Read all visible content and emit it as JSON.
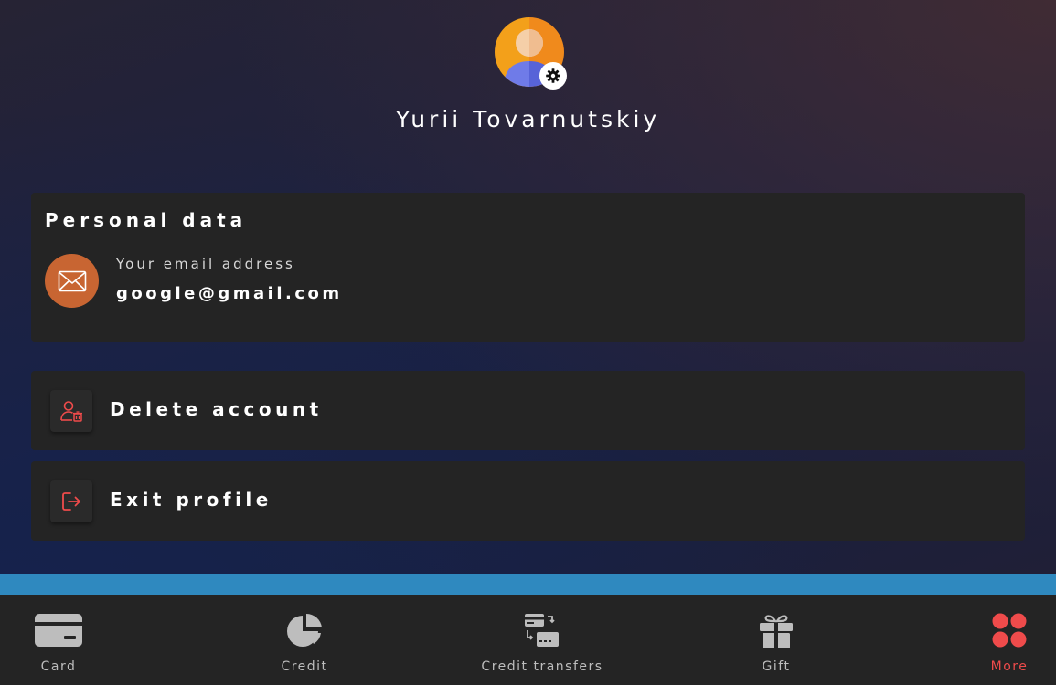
{
  "profile": {
    "name": "Yurii Tovarnutskiy",
    "avatar_icon": "user-avatar-icon",
    "settings_icon": "gear-icon"
  },
  "personal_data": {
    "title": "Personal data",
    "email_label": "Your email address",
    "email_value": "google@gmail.com",
    "email_icon": "envelope-icon"
  },
  "actions": {
    "delete_account": {
      "label": "Delete account",
      "icon": "user-delete-icon"
    },
    "exit_profile": {
      "label": "Exit profile",
      "icon": "logout-icon"
    }
  },
  "bottom_nav": {
    "card": {
      "label": "Card",
      "icon": "credit-card-icon"
    },
    "credit": {
      "label": "Credit",
      "icon": "pie-chart-icon"
    },
    "credit_transfers": {
      "label": "Credit transfers",
      "icon": "transfer-icon"
    },
    "gift": {
      "label": "Gift",
      "icon": "gift-icon"
    },
    "more": {
      "label": "More",
      "icon": "more-dots-icon",
      "active": true
    }
  },
  "colors": {
    "accent_red": "#ef4b4b",
    "info_strip_blue": "#2f89bf",
    "email_badge_orange": "#c86532",
    "card_background": "#242424"
  }
}
